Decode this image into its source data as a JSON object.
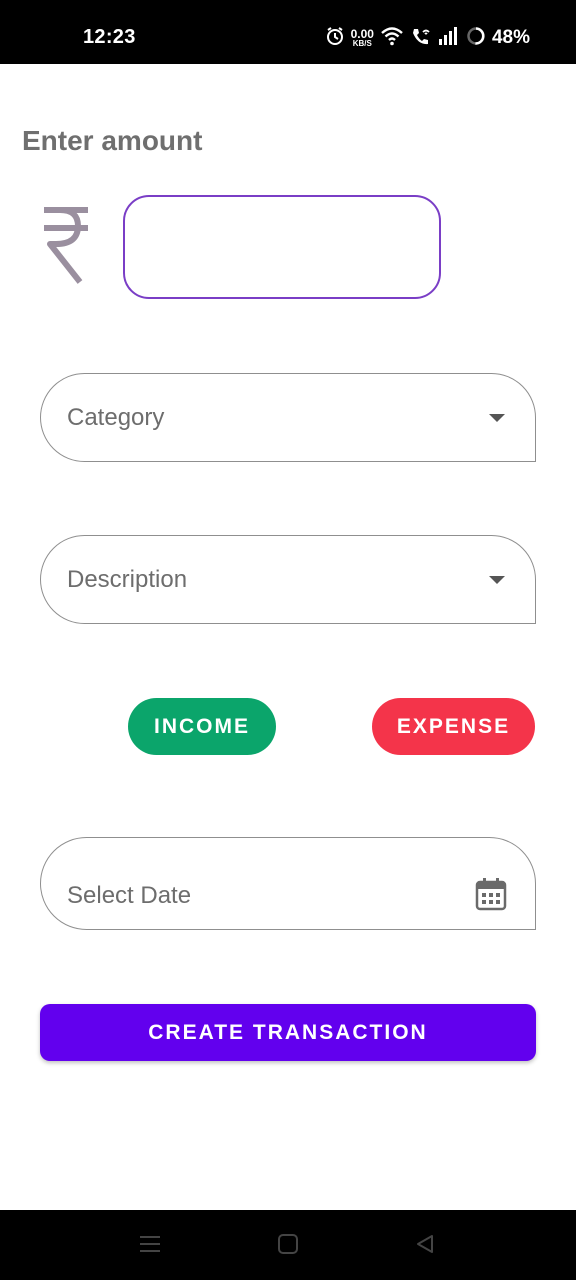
{
  "status_bar": {
    "time": "12:23",
    "net_speed_value": "0.00",
    "net_speed_unit": "KB/S",
    "battery_percent": "48%",
    "icons": [
      "alarm-icon",
      "wifi-icon",
      "wifi-calling-icon",
      "signal-icon",
      "battery-icon"
    ]
  },
  "form": {
    "amount_label": "Enter amount",
    "currency_symbol": "₹",
    "amount_value": "",
    "category_label": "Category",
    "description_label": "Description",
    "income_label": "INCOME",
    "expense_label": "EXPENSE",
    "date_label": "Select Date",
    "create_label": "CREATE TRANSACTION"
  },
  "colors": {
    "accent": "#6200ee",
    "amount_border": "#7a3ec6",
    "income": "#0ba56b",
    "expense": "#f4344a"
  },
  "nav_bar": {
    "icons": [
      "menu-icon",
      "home-icon",
      "back-icon"
    ]
  }
}
